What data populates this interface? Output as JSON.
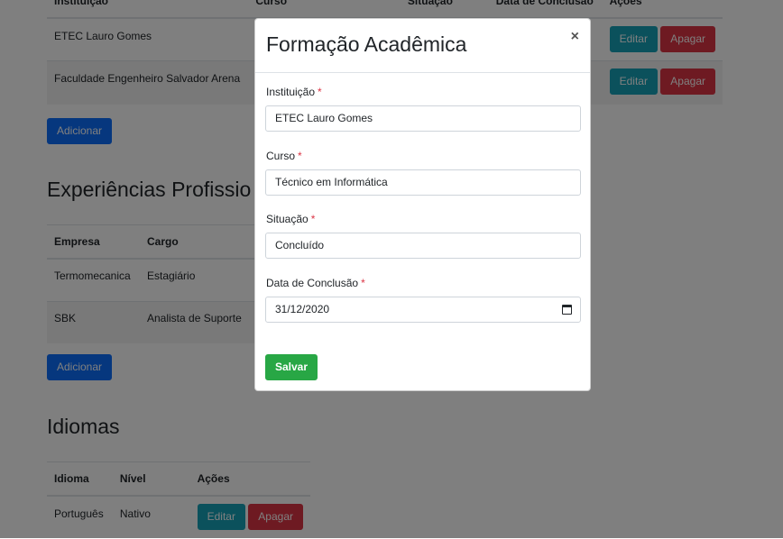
{
  "formacao_table": {
    "headers": [
      "Instituição",
      "Curso",
      "Situação",
      "Data de Conclusão",
      "Ações"
    ],
    "rows": [
      {
        "instituicao": "ETEC Lauro Gomes"
      },
      {
        "instituicao": "Faculdade Engenheiro Salvador Arena"
      }
    ],
    "edit_label": "Editar",
    "delete_label": "Apagar",
    "add_label": "Adicionar"
  },
  "experiencias": {
    "title": "Experiências Profissio",
    "headers": [
      "Empresa",
      "Cargo"
    ],
    "rows": [
      {
        "empresa": "Termomecanica",
        "cargo": "Estagiário"
      },
      {
        "empresa": "SBK",
        "cargo": "Analista de Suporte"
      }
    ],
    "add_label": "Adicionar"
  },
  "idiomas": {
    "title": "Idiomas",
    "headers": [
      "Idioma",
      "Nível",
      "Ações"
    ],
    "rows": [
      {
        "idioma": "Português",
        "nivel": "Nativo"
      }
    ],
    "edit_label": "Editar",
    "delete_label": "Apagar"
  },
  "modal": {
    "title": "Formação Acadêmica",
    "close_label": "×",
    "required_mark": "*",
    "fields": {
      "instituicao": {
        "label": "Instituição",
        "value": "ETEC Lauro Gomes"
      },
      "curso": {
        "label": "Curso",
        "value": "Técnico em Informática"
      },
      "situacao": {
        "label": "Situação",
        "value": "Concluído"
      },
      "data": {
        "label": "Data de Conclusão",
        "value": "31/12/2020"
      }
    },
    "save_label": "Salvar"
  },
  "colors": {
    "primary": "#0d6efd",
    "info": "#17a2b8",
    "danger": "#dc3545",
    "success": "#28a745"
  }
}
